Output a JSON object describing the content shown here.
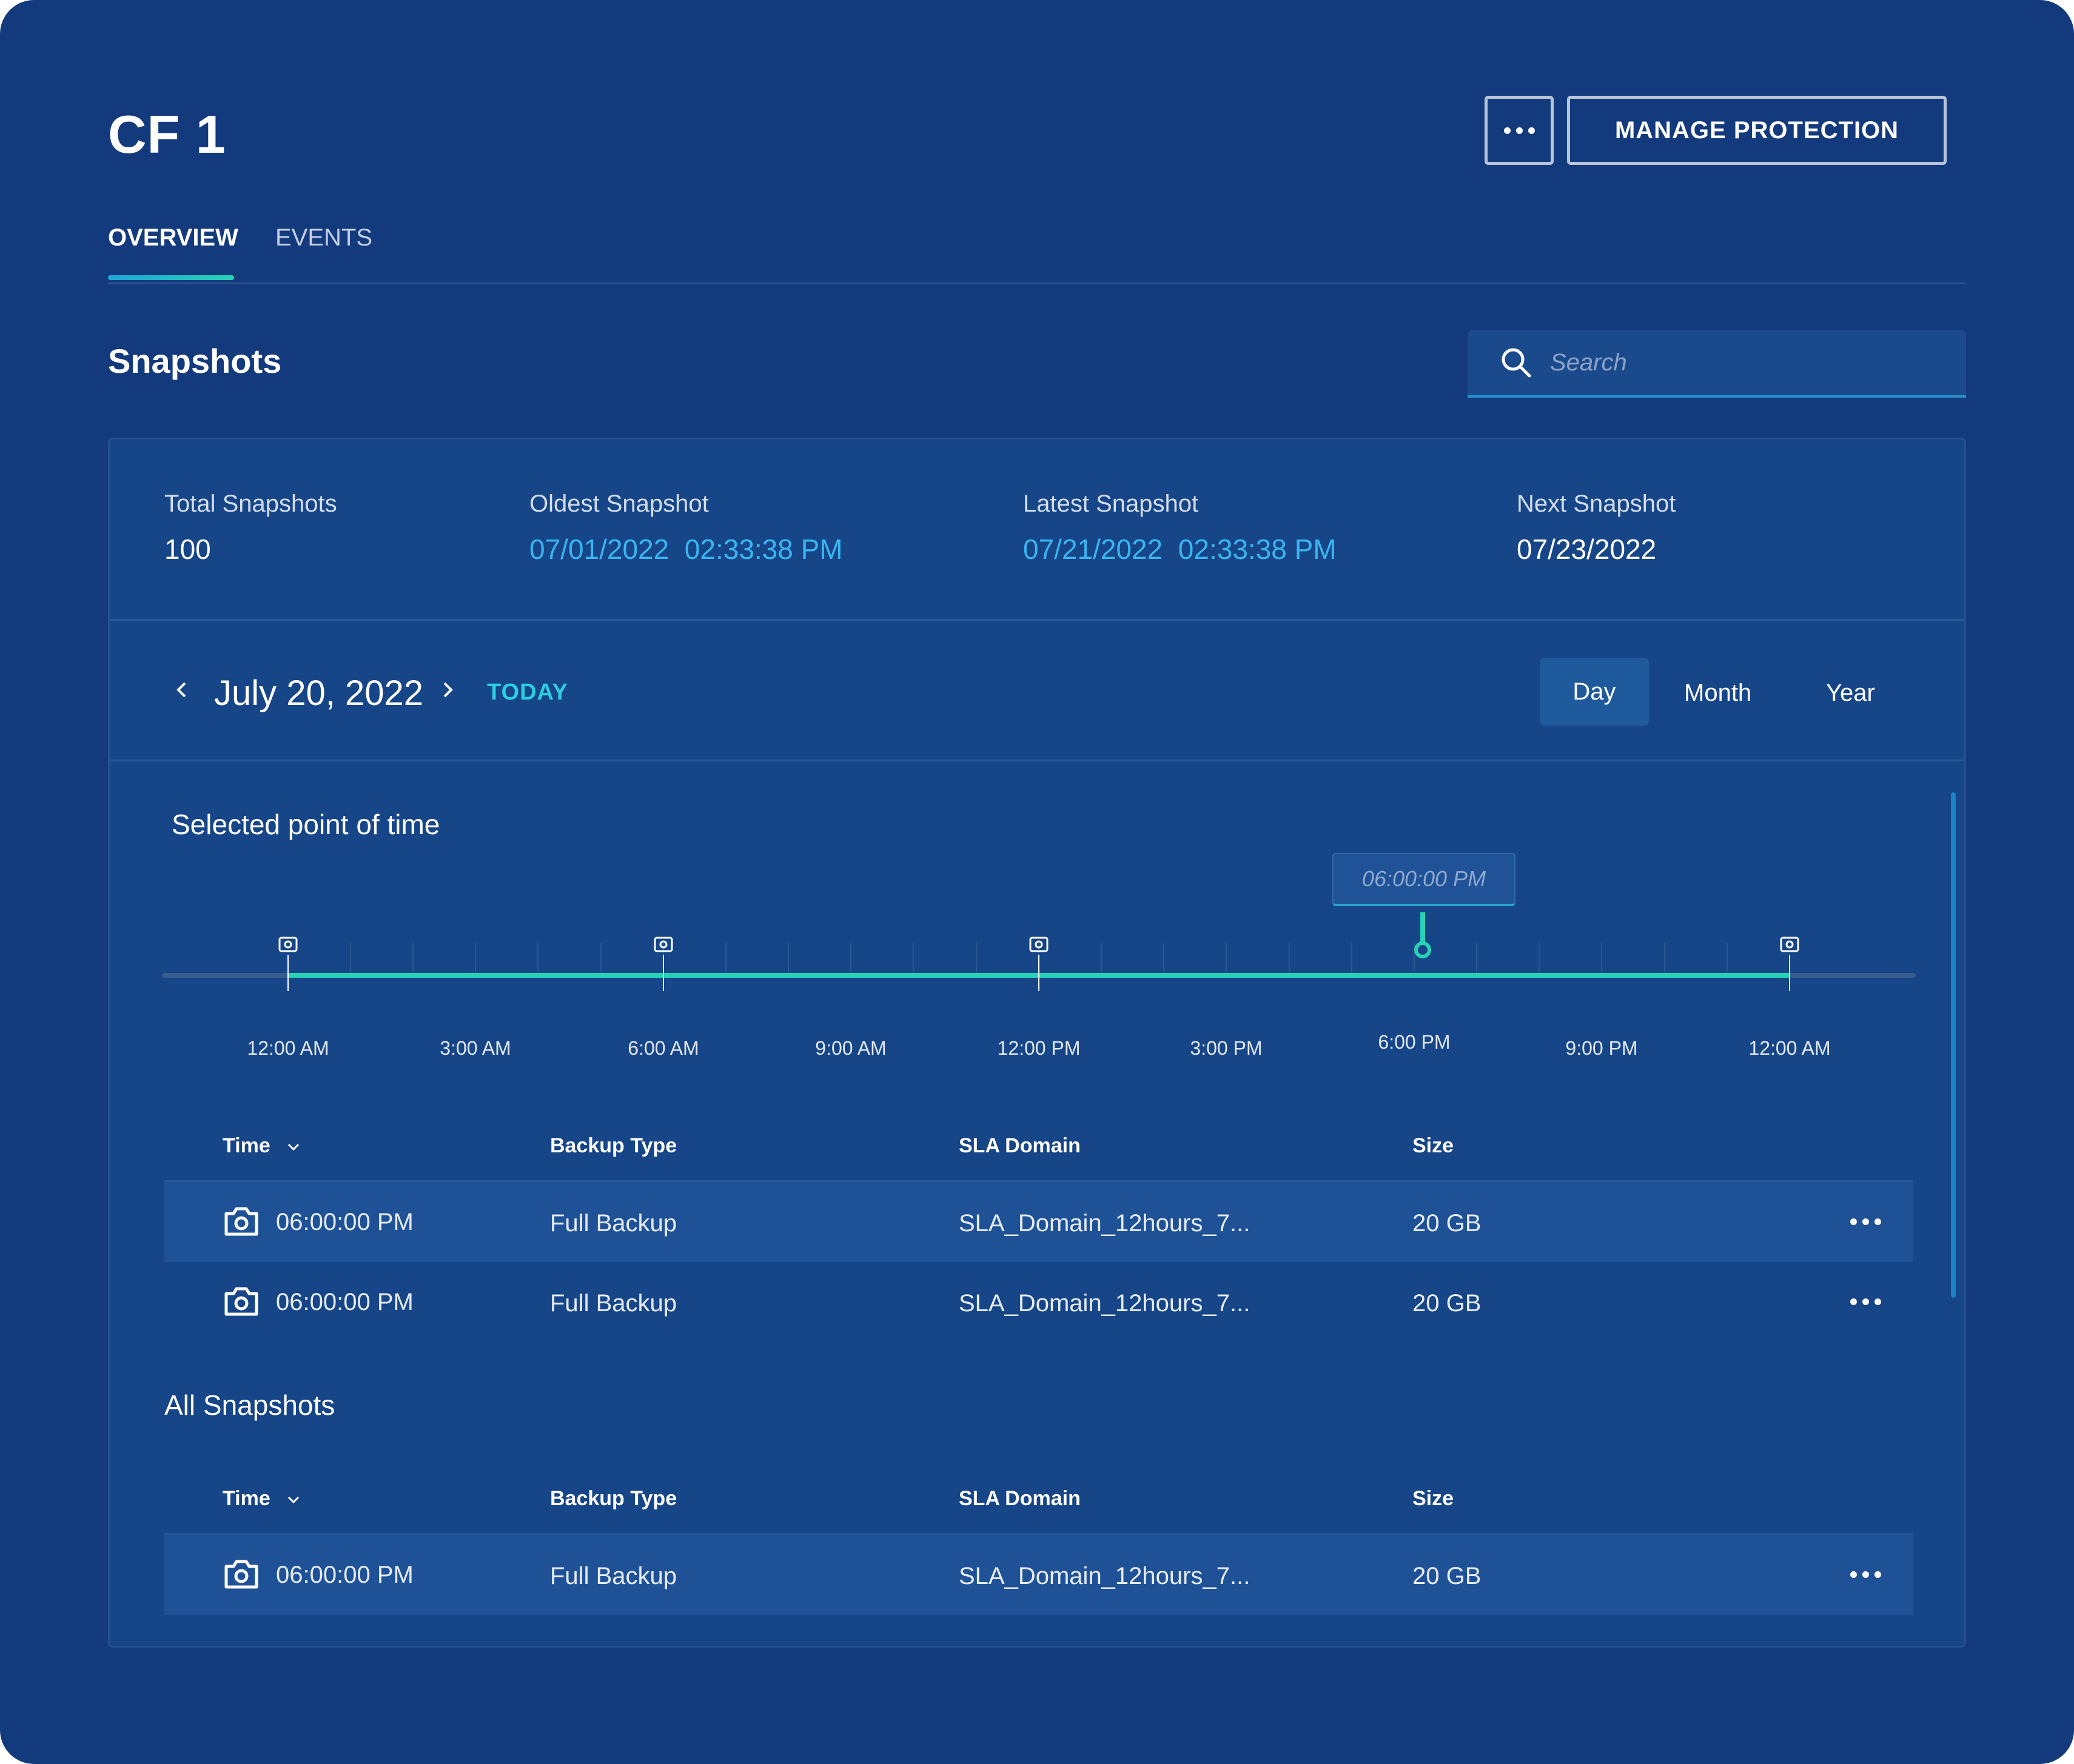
{
  "page": {
    "title": "CF 1",
    "more_label": "more options",
    "manage_label": "MANAGE PROTECTION"
  },
  "tabs": [
    {
      "label": "OVERVIEW",
      "active": true
    },
    {
      "label": "EVENTS",
      "active": false
    }
  ],
  "snapshots": {
    "heading": "Snapshots",
    "search_placeholder": "Search",
    "stats": [
      {
        "label": "Total Snapshots",
        "value": "100",
        "is_link": false
      },
      {
        "label": "Oldest Snapshot",
        "value": "07/01/2022  02:33:38 PM",
        "is_link": true
      },
      {
        "label": "Latest Snapshot",
        "value": "07/21/2022  02:33:38 PM",
        "is_link": true
      },
      {
        "label": "Next Snapshot",
        "value": "07/23/2022",
        "is_link": false
      }
    ],
    "date_nav": {
      "date": "July 20, 2022",
      "today": "TODAY",
      "views": [
        "Day",
        "Month",
        "Year"
      ],
      "selected_view": "Day"
    },
    "selected_point": {
      "heading": "Selected point of time",
      "tooltip": "06:00:00 PM",
      "timeline_ticks": [
        "12:00 AM",
        "3:00 AM",
        "6:00 AM",
        "9:00 AM",
        "12:00 PM",
        "3:00 PM",
        "6:00 PM",
        "9:00 PM",
        "12:00 AM"
      ]
    },
    "columns": {
      "time": "Time",
      "backup_type": "Backup Type",
      "sla_domain": "SLA Domain",
      "size": "Size"
    },
    "selected_rows": [
      {
        "time": "06:00:00 PM",
        "backup_type": "Full Backup",
        "sla_domain": "SLA_Domain_12hours_7...",
        "size": "20 GB"
      },
      {
        "time": "06:00:00 PM",
        "backup_type": "Full Backup",
        "sla_domain": "SLA_Domain_12hours_7...",
        "size": "20 GB"
      }
    ],
    "all_heading": "All Snapshots",
    "all_rows": [
      {
        "time": "06:00:00 PM",
        "backup_type": "Full Backup",
        "sla_domain": "SLA_Domain_12hours_7...",
        "size": "20 GB"
      }
    ]
  },
  "colors": {
    "background": "#133a7c",
    "panel": "#164588",
    "accent_teal": "#28d2b4",
    "link_blue": "#3bb5f0"
  }
}
